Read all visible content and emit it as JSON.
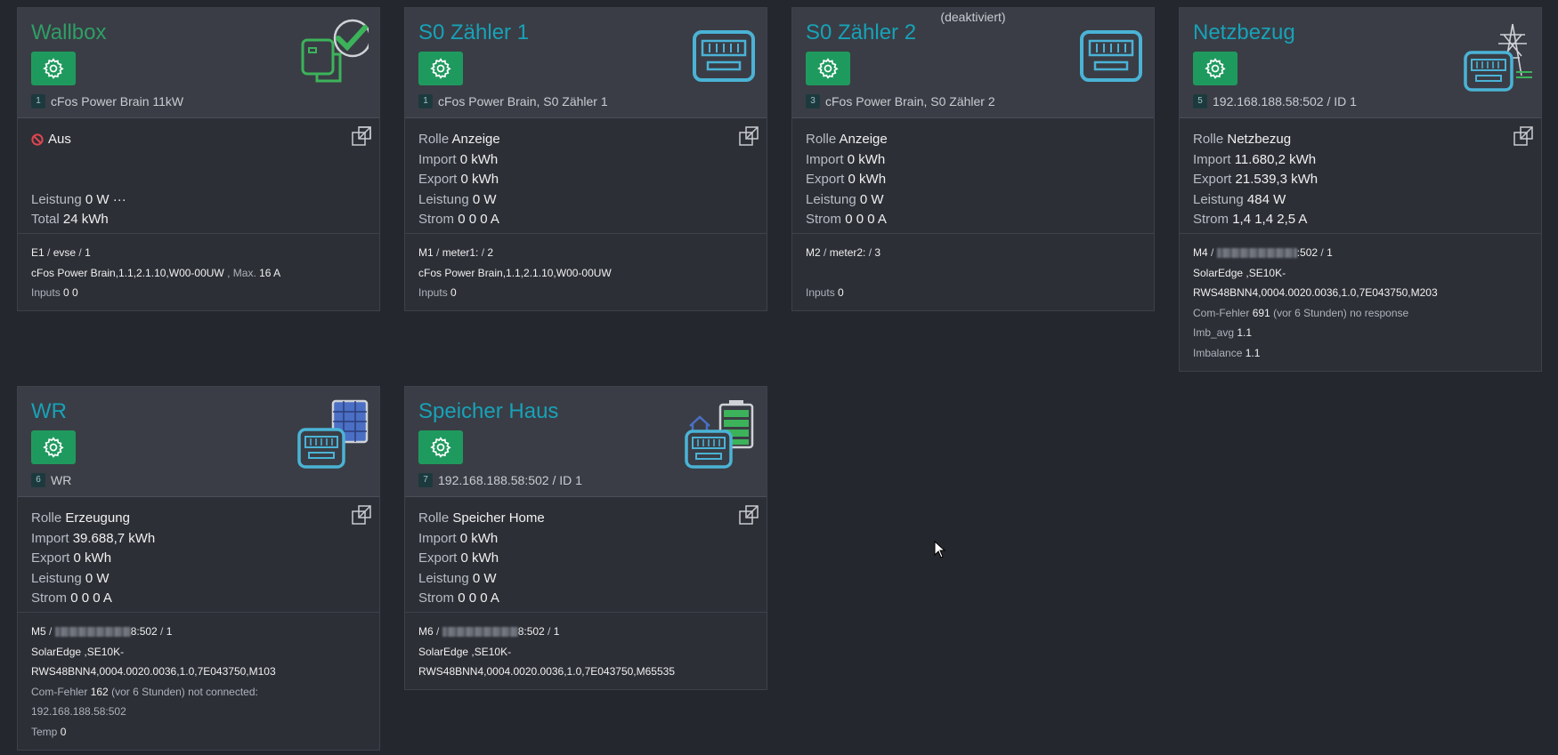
{
  "cards": [
    {
      "title": "Wallbox",
      "num": "1",
      "subtitle": "cFos Power Brain 11kW",
      "status": "Aus",
      "leistung_label": "Leistung",
      "leistung_value": "0 W",
      "leistung_dots": "···",
      "total_label": "Total",
      "total_value": "24 kWh",
      "foot_line1_a": "E1",
      "foot_line1_b": "evse",
      "foot_line1_c": "1",
      "foot_line2": "cFos Power Brain,1.1,2.1.10,W00-00UW",
      "foot_max_label": ", Max.",
      "foot_max_value": "16 A",
      "inputs_label": "Inputs",
      "inputs_value": "0 0"
    },
    {
      "title": "S0 Zähler 1",
      "num": "1",
      "subtitle": "cFos Power Brain, S0 Zähler 1",
      "rolle_label": "Rolle",
      "rolle_value": "Anzeige",
      "import_label": "Import",
      "import_value": "0 kWh",
      "export_label": "Export",
      "export_value": "0 kWh",
      "leistung_label": "Leistung",
      "leistung_value": "0 W",
      "strom_label": "Strom",
      "strom_value": "0 0 0 A",
      "foot_line1_a": "M1",
      "foot_line1_b": "meter1:",
      "foot_line1_c": "2",
      "foot_line2": "cFos Power Brain,1.1,2.1.10,W00-00UW",
      "inputs_label": "Inputs",
      "inputs_value": "0"
    },
    {
      "title": "S0 Zähler 2",
      "deactivated": "(deaktiviert)",
      "num": "3",
      "subtitle": "cFos Power Brain, S0 Zähler 2",
      "rolle_label": "Rolle",
      "rolle_value": "Anzeige",
      "import_label": "Import",
      "import_value": "0 kWh",
      "export_label": "Export",
      "export_value": "0 kWh",
      "leistung_label": "Leistung",
      "leistung_value": "0 W",
      "strom_label": "Strom",
      "strom_value": "0 0 0 A",
      "foot_line1_a": "M2",
      "foot_line1_b": "meter2:",
      "foot_line1_c": "3",
      "inputs_label": "Inputs",
      "inputs_value": "0"
    },
    {
      "title": "Netzbezug",
      "num": "5",
      "subtitle": "192.168.188.58:502 / ID 1",
      "rolle_label": "Rolle",
      "rolle_value": "Netzbezug",
      "import_label": "Import",
      "import_value": "11.680,2 kWh",
      "export_label": "Export",
      "export_value": "21.539,3 kWh",
      "leistung_label": "Leistung",
      "leistung_value": "484 W",
      "strom_label": "Strom",
      "strom_value": "1,4 1,4 2,5 A",
      "foot_line1_a": "M4",
      "foot_line1_port": ":502",
      "foot_line1_c": "1",
      "foot_line2": "SolarEdge ,SE10K-",
      "foot_line3": "RWS48BNN4,0004.0020.0036,1.0,7E043750,M203",
      "err_label": "Com-Fehler",
      "err_value": "691",
      "err_text": "(vor 6 Stunden) no response",
      "imb_avg_label": "Imb_avg",
      "imb_avg_value": "1.1",
      "imbalance_label": "Imbalance",
      "imbalance_value": "1.1"
    },
    {
      "title": "WR",
      "num": "6",
      "subtitle": "WR",
      "rolle_label": "Rolle",
      "rolle_value": "Erzeugung",
      "import_label": "Import",
      "import_value": "39.688,7 kWh",
      "export_label": "Export",
      "export_value": "0 kWh",
      "leistung_label": "Leistung",
      "leistung_value": "0 W",
      "strom_label": "Strom",
      "strom_value": "0 0 0 A",
      "foot_line1_a": "M5",
      "foot_line1_port": "8:502",
      "foot_line1_c": "1",
      "foot_line2": "SolarEdge ,SE10K-",
      "foot_line3": "RWS48BNN4,0004.0020.0036,1.0,7E043750,M103",
      "err_label": "Com-Fehler",
      "err_value": "162",
      "err_text": "(vor 6 Stunden) not connected:",
      "err_text2": "192.168.188.58:502",
      "temp_label": "Temp",
      "temp_value": "0"
    },
    {
      "title": "Speicher Haus",
      "num": "7",
      "subtitle": "192.168.188.58:502 / ID 1",
      "rolle_label": "Rolle",
      "rolle_value": "Speicher Home",
      "import_label": "Import",
      "import_value": "0 kWh",
      "export_label": "Export",
      "export_value": "0 kWh",
      "leistung_label": "Leistung",
      "leistung_value": "0 W",
      "strom_label": "Strom",
      "strom_value": "0 0 0 A",
      "foot_line1_a": "M6",
      "foot_line1_port": "8:502",
      "foot_line1_c": "1",
      "foot_line2": "SolarEdge ,SE10K-",
      "foot_line3": "RWS48BNN4,0004.0020.0036,1.0,7E043750,M65535"
    }
  ],
  "icons": {
    "gear": "gear-icon",
    "external": "external-link-icon",
    "wallbox": "wallbox-check-icon",
    "meter": "meter-icon",
    "grid": "power-pylon-meter-icon",
    "solar": "solar-panel-meter-icon",
    "battery": "house-battery-meter-icon",
    "status": "prohibited-icon"
  },
  "colors": {
    "accent_title": "#17a2b8",
    "gear_button": "#1f9a5e",
    "wallbox_title": "#2f9e66",
    "status_red": "#e0454f"
  }
}
